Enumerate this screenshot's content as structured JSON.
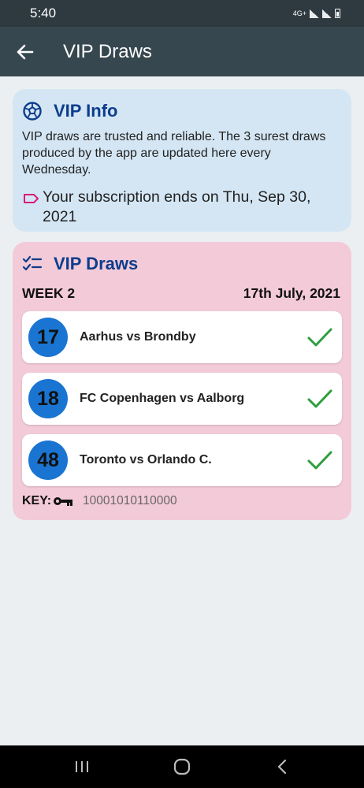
{
  "status_bar": {
    "time": "5:40",
    "network": "4G+"
  },
  "app_bar": {
    "title": "VIP Draws"
  },
  "info": {
    "title": "VIP Info",
    "description": "VIP draws are trusted and reliable. The 3 surest draws produced by the app are updated here every Wednesday.",
    "subscription": "Your subscription ends on Thu, Sep 30, 2021"
  },
  "draws": {
    "title": "VIP Draws",
    "week": "WEEK 2",
    "date": "17th July, 2021",
    "items": [
      {
        "number": "17",
        "match": "Aarhus vs Brondby"
      },
      {
        "number": "18",
        "match": "FC Copenhagen vs Aalborg"
      },
      {
        "number": "48",
        "match": "Toronto vs Orlando C."
      }
    ],
    "key_label": "KEY:",
    "key_value": "10001010110000"
  },
  "colors": {
    "app_bar": "#37474f",
    "info_card": "#d4e6f4",
    "draws_card": "#f3cad8",
    "accent_title": "#0d3d8c",
    "number_circle": "#1a75d2",
    "check": "#2e9e3e"
  }
}
